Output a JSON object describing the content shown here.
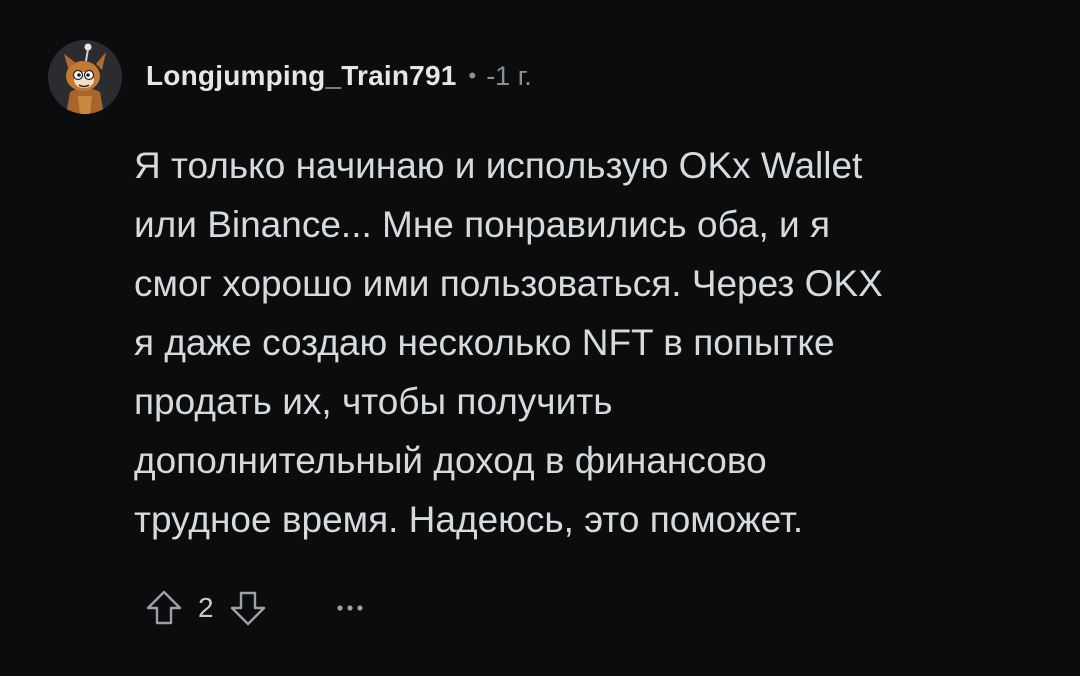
{
  "comment": {
    "author": "Longjumping_Train791",
    "separator": "•",
    "age": "-1 г.",
    "body_lines": [
      "Я только начинаю и использую OKx Wallet",
      "или Binance... Мне понравились оба, и я",
      "смог хорошо ими пользоваться. Через OKX",
      "я даже создаю несколько NFT в попытке",
      "продать их, чтобы получить",
      "дополнительный доход в финансово",
      "трудное время. Надеюсь, это поможет."
    ],
    "score": "2"
  },
  "icons": {
    "avatar": "avatar-illustration",
    "upvote": "arrow-up-outline-icon",
    "downvote": "arrow-down-outline-icon",
    "more": "more-horizontal-icon"
  },
  "colors": {
    "background": "#0b0c0e",
    "text": "#d7dadc",
    "muted": "#8a8f94"
  }
}
